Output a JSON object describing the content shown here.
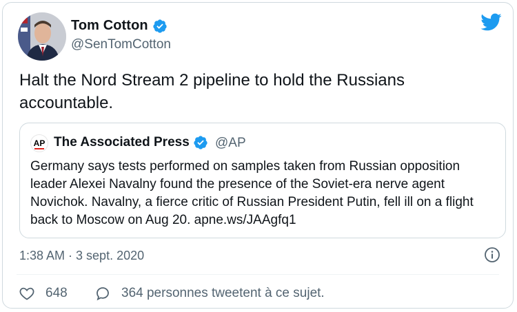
{
  "tweet": {
    "author_name": "Tom Cotton",
    "author_handle": "@SenTomCotton",
    "text": "Halt the Nord Stream 2 pipeline to hold the Russians accountable.",
    "timestamp": "1:38 AM · 3 sept. 2020",
    "like_count": "648",
    "reply_label": "364 personnes tweetent à ce sujet."
  },
  "quoted": {
    "logo_text": "AP",
    "author_name": "The Associated Press",
    "author_handle": "@AP",
    "text": "Germany says tests performed on samples taken from Russian opposition leader Alexei Navalny found the presence of the Soviet-era nerve agent Novichok. Navalny, a fierce critic of Russian President Putin, fell ill on a flight back to Moscow on Aug 20. apne.ws/JAAgfq1"
  },
  "icons": {
    "brand": "twitter-bird-icon",
    "verified": "verified-badge-icon",
    "like": "heart-icon",
    "reply": "speech-bubble-icon",
    "info": "info-icon"
  },
  "colors": {
    "twitter_blue": "#1d9bf0",
    "text_primary": "#0f1419",
    "text_secondary": "#536471",
    "border": "#cfd9de",
    "ap_red": "#e0231c"
  }
}
